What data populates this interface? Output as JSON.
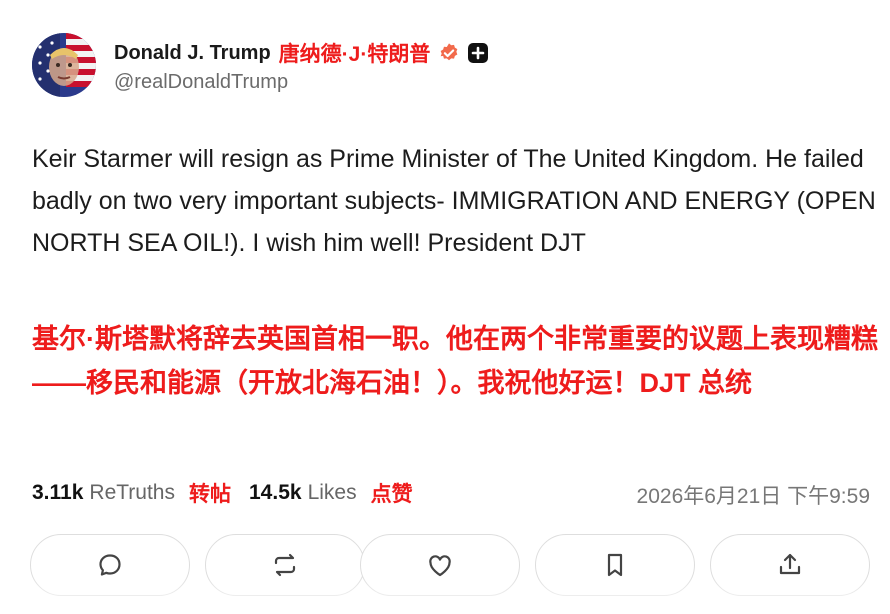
{
  "profile": {
    "name": "Donald J. Trump",
    "name_cn": "唐纳德·J·特朗普",
    "handle": "@realDonaldTrump",
    "verified_icon": "verified-badge-icon",
    "platform_icon": "plus-badge-icon",
    "avatar_icon": "flag-portrait-avatar"
  },
  "post": {
    "text": "Keir Starmer will resign as Prime Minister of The United Kingdom. He failed badly on two very important subjects- IMMIGRATION AND ENERGY (OPEN NORTH SEA OIL!). I wish him well! President DJT",
    "translation": "基尔·斯塔默将辞去英国首相一职。他在两个非常重要的议题上表现糟糕——移民和能源（开放北海石油！）。我祝他好运！DJT 总统"
  },
  "stats": {
    "retruths_count": "3.11k",
    "retruths_label": "ReTruths",
    "retruths_cn": "转帖",
    "likes_count": "14.5k",
    "likes_label": "Likes",
    "likes_cn": "点赞",
    "timestamp": "2026年6月21日 下午9:59"
  },
  "actions": [
    {
      "icon": "reply-icon"
    },
    {
      "icon": "retruth-icon"
    },
    {
      "icon": "like-icon"
    },
    {
      "icon": "bookmark-icon"
    },
    {
      "icon": "share-icon"
    }
  ],
  "colors": {
    "accent_red": "#ee1c1c",
    "verified_orange": "#f26a4b",
    "muted_gray": "#6b6b6b",
    "border_gray": "#dedede"
  }
}
